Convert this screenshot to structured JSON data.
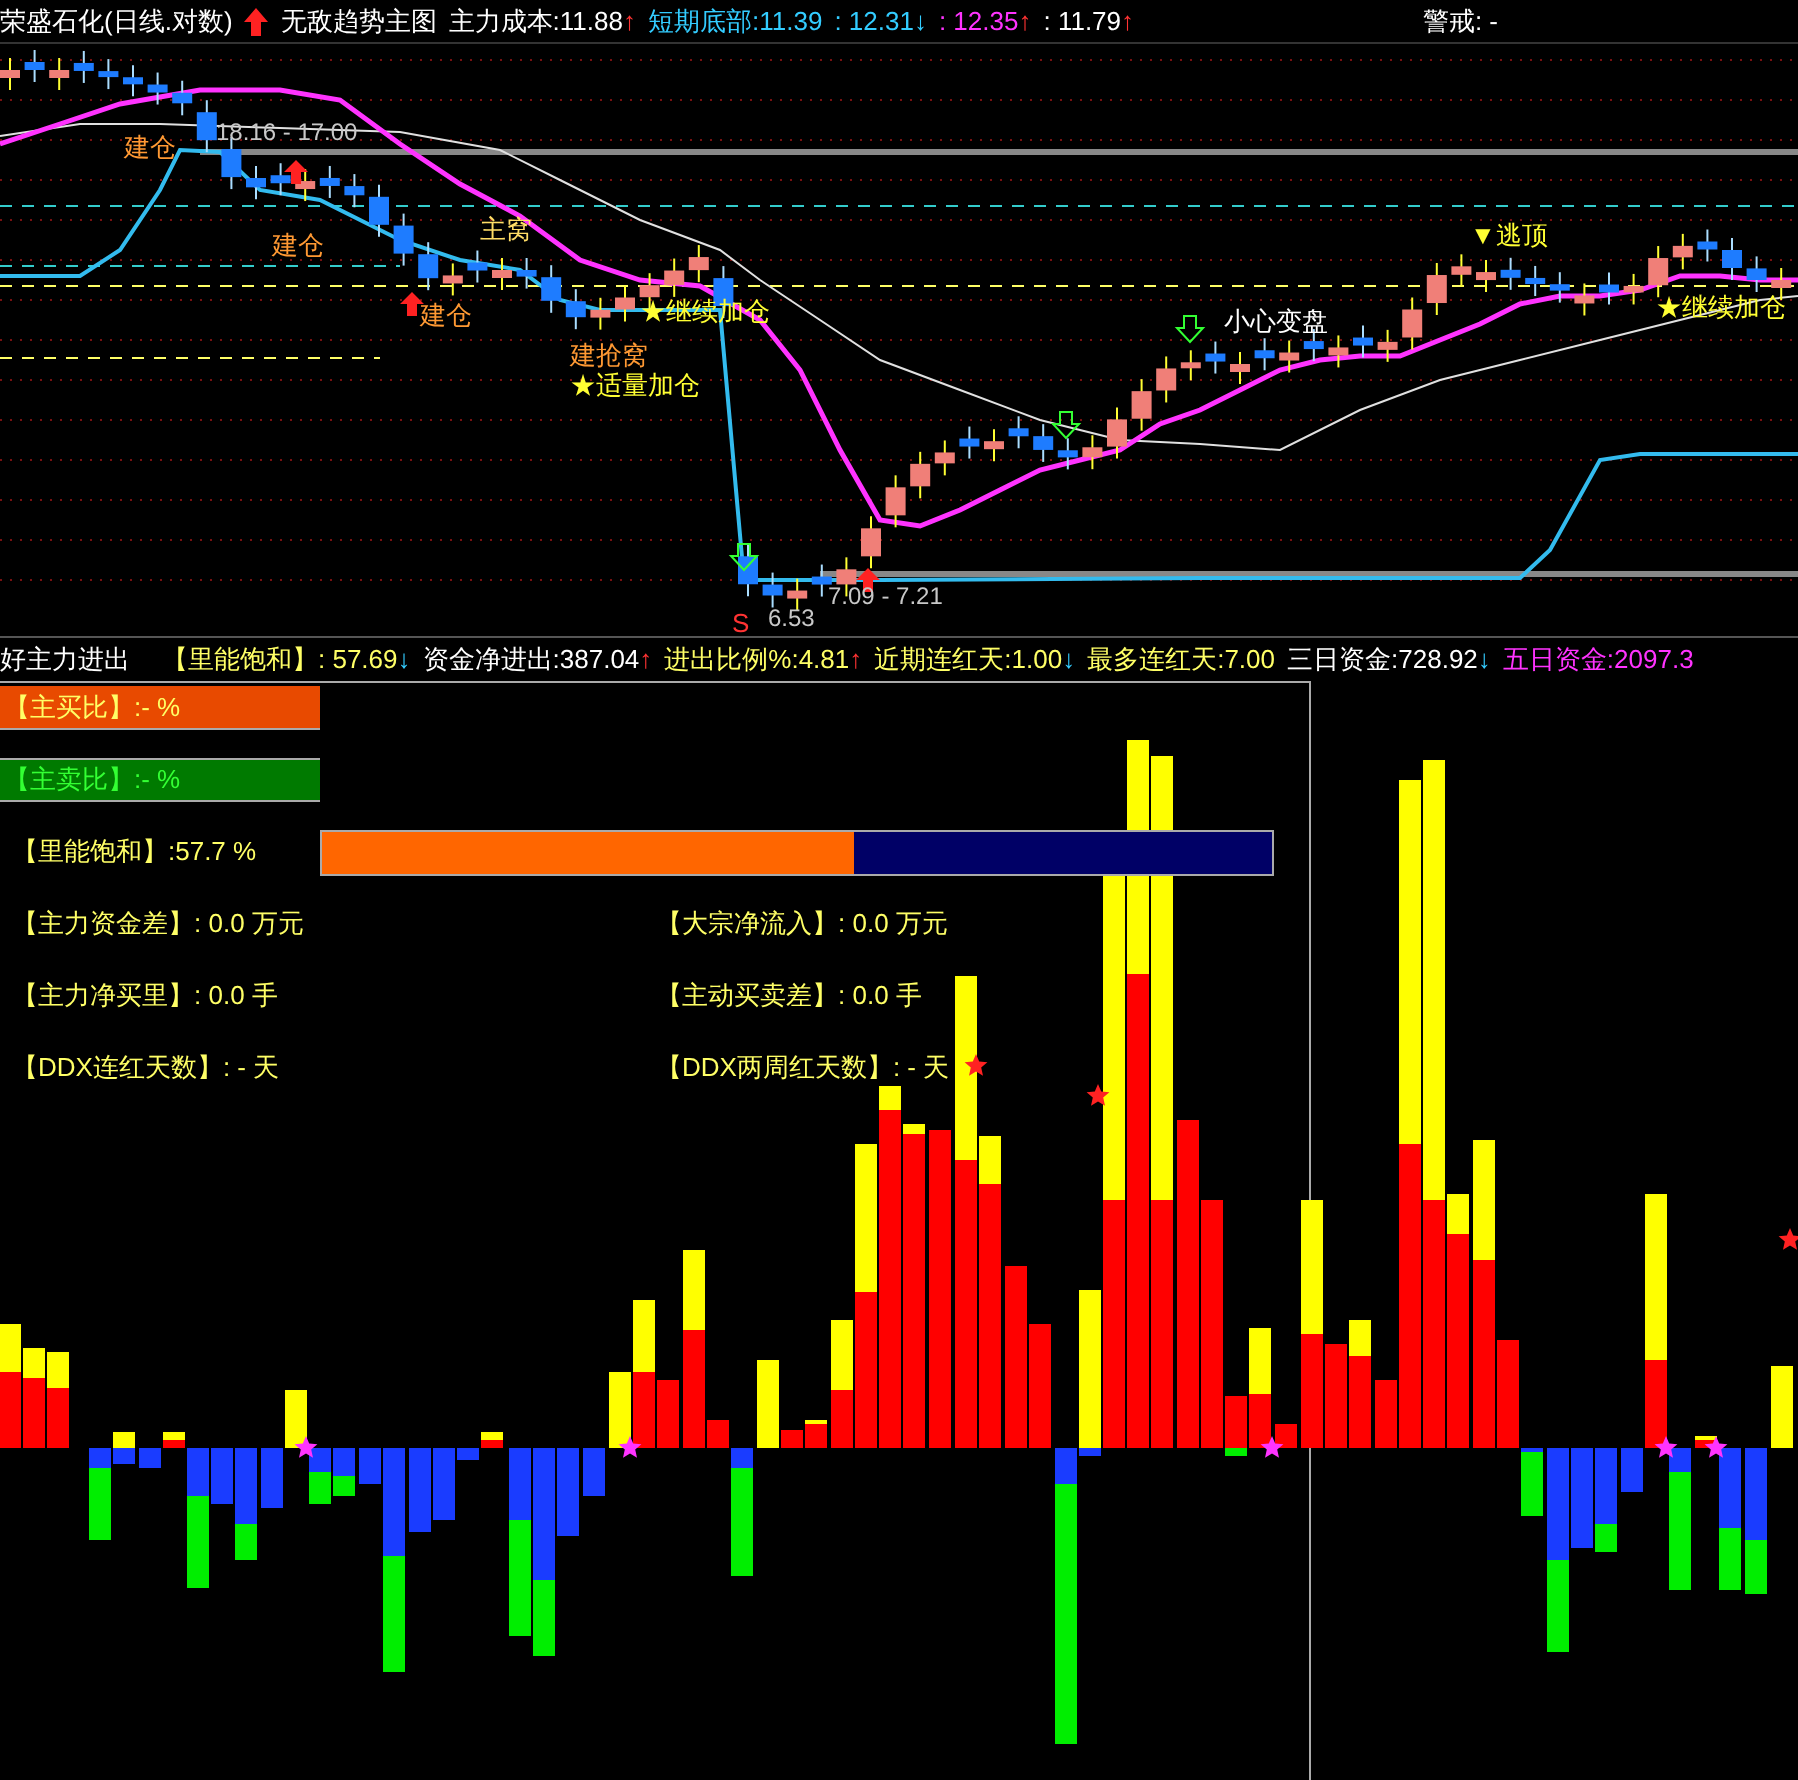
{
  "header": {
    "title": "荣盛石化(日线.对数)",
    "indicator": "无敌趋势主图",
    "items": [
      {
        "label": "主力成本:",
        "value": "11.88",
        "arrow": "↑",
        "rising": true,
        "color": "#ffffff"
      },
      {
        "label": "短期底部:",
        "value": "11.39",
        "color": "#33ccff"
      },
      {
        "value": ": 12.31",
        "arrow": "↓",
        "rising": false,
        "color": "#33ccff"
      },
      {
        "value": ": 12.35",
        "arrow": "↑",
        "rising": true,
        "color": "#ff33ff"
      },
      {
        "value": ": 11.79",
        "arrow": "↑",
        "rising": true,
        "color": "#ffffff"
      }
    ],
    "alert": "警戒: -"
  },
  "chart_annotations": [
    {
      "kind": "level",
      "text": "18.16 - 17.00"
    },
    {
      "kind": "buy",
      "text": "建仓"
    },
    {
      "kind": "buy",
      "text": "建仓"
    },
    {
      "kind": "buy",
      "text": "建仓"
    },
    {
      "kind": "nest",
      "text": "主窝"
    },
    {
      "kind": "buy",
      "text": "建抢窝"
    },
    {
      "kind": "add",
      "text": "★适量加仓"
    },
    {
      "kind": "add",
      "text": "★继续加仓"
    },
    {
      "kind": "level",
      "text": "6.53"
    },
    {
      "kind": "level",
      "text": "7.09 - 7.21"
    },
    {
      "kind": "sell",
      "text": "S"
    },
    {
      "kind": "warn",
      "text": "小心变盘"
    },
    {
      "kind": "add",
      "text": "▼逃顶"
    },
    {
      "kind": "add",
      "text": "★继续加仓"
    }
  ],
  "indicator_bar": {
    "title": "好主力进出",
    "items": [
      {
        "label": "【里能饱和】",
        "value": ": 57.69",
        "arrow": "↓",
        "rising": false,
        "color": "#ffff66"
      },
      {
        "label": "资金净进出:",
        "value": "387.04",
        "arrow": "↑",
        "rising": true,
        "color": "#ffffff"
      },
      {
        "label": "进出比例%:",
        "value": "4.81",
        "arrow": "↑",
        "rising": true,
        "color": "#ffff66"
      },
      {
        "label": "近期连红天:",
        "value": "1.00",
        "arrow": "↓",
        "rising": false,
        "color": "#ffff66"
      },
      {
        "label": "最多连红天:",
        "value": "7.00",
        "color": "#ffff66"
      },
      {
        "label": "三日资金:",
        "value": "728.92",
        "arrow": "↓",
        "rising": false,
        "color": "#ffffff"
      },
      {
        "label": "五日资金:",
        "value": "2097.3",
        "color": "#ff33ff"
      }
    ]
  },
  "panel": {
    "buy_ratio": "【主买比】:- %",
    "sell_ratio": "【主卖比】:- %",
    "saturation": {
      "label": "【里能饱和】:57.7 %",
      "level": 0.56
    },
    "stats": [
      {
        "text": "【主力资金差】: 0.0 万元"
      },
      {
        "text": "【大宗净流入】: 0.0 万元"
      },
      {
        "text": "【主力净买里】: 0.0 手"
      },
      {
        "text": "【主动买卖差】: 0.0 手"
      },
      {
        "text": "【DDX连红天数】: - 天"
      },
      {
        "text": "【DDX两周红天数】: - 天"
      }
    ]
  }
}
